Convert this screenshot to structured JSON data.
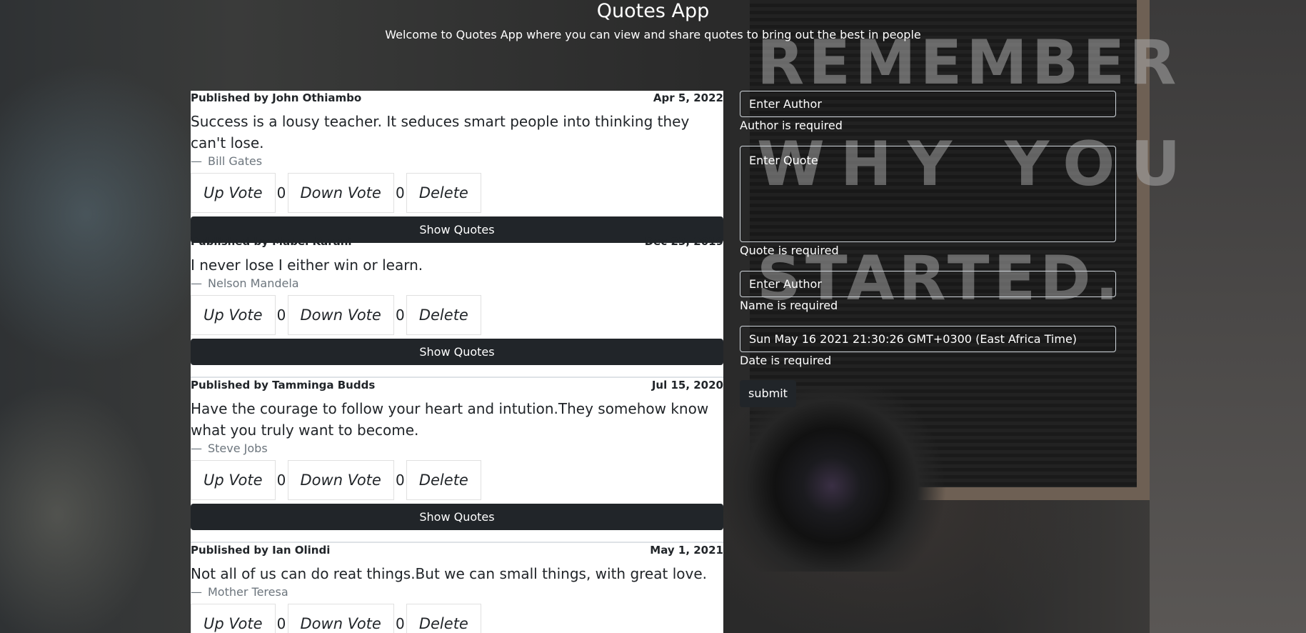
{
  "header": {
    "title": "Quotes App",
    "subtitle": "Welcome to Quotes App where you can view and share quotes to bring out the best in people"
  },
  "background_text": [
    "REMEMBER",
    "WHY YOU",
    "STARTED."
  ],
  "quotes": [
    {
      "publisher": "Published by John Othiambo",
      "date": "Apr 5, 2022",
      "text": "Success is a lousy teacher. It seduces smart people into thinking they can't lose.",
      "author": "Bill Gates",
      "upvote_label": "Up Vote",
      "upvotes": "0",
      "downvote_label": "Down Vote",
      "downvotes": "0",
      "delete_label": "Delete",
      "show_label": "Show Quotes"
    },
    {
      "publisher": "Published by Mabel Karani",
      "date": "Dec 23, 2019",
      "text": "I never lose I either win or learn.",
      "author": "Nelson Mandela",
      "upvote_label": "Up Vote",
      "upvotes": "0",
      "downvote_label": "Down Vote",
      "downvotes": "0",
      "delete_label": "Delete",
      "show_label": "Show Quotes"
    },
    {
      "publisher": "Published by Tamminga Budds",
      "date": "Jul 15, 2020",
      "text": "Have the courage to follow your heart and intution.They somehow know what you truly want to become.",
      "author": "Steve Jobs",
      "upvote_label": "Up Vote",
      "upvotes": "0",
      "downvote_label": "Down Vote",
      "downvotes": "0",
      "delete_label": "Delete",
      "show_label": "Show Quotes"
    },
    {
      "publisher": "Published by Ian Olindi",
      "date": "May 1, 2021",
      "text": "Not all of us can do reat things.But we can small things, with great love.",
      "author": "Mother Teresa",
      "upvote_label": "Up Vote",
      "upvotes": "0",
      "downvote_label": "Down Vote",
      "downvotes": "0",
      "delete_label": "Delete"
    }
  ],
  "form": {
    "author_placeholder": "Enter Author",
    "author_error": "Author is required",
    "quote_placeholder": "Enter Quote",
    "quote_error": "Quote is required",
    "name_placeholder": "Enter Author",
    "name_error": "Name is required",
    "date_value": "Sun May 16 2021 21:30:26 GMT+0300 (East Africa Time)",
    "date_error": "Date is required",
    "submit_label": "submit"
  }
}
